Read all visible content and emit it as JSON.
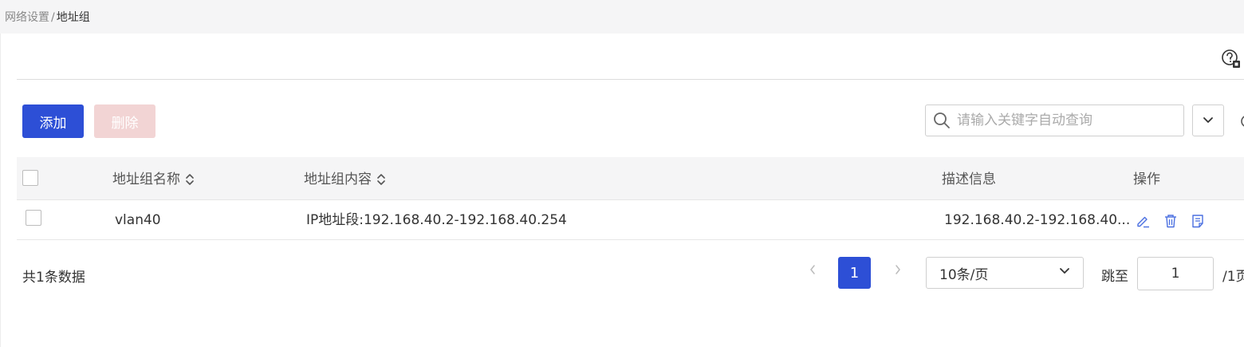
{
  "breadcrumb": {
    "parent": "网络设置",
    "separator": "/",
    "current": "地址组"
  },
  "toolbar": {
    "add_label": "添加",
    "delete_label": "删除"
  },
  "search": {
    "placeholder": "请输入关键字自动查询",
    "value": ""
  },
  "table": {
    "columns": [
      "地址组名称",
      "地址组内容",
      "描述信息",
      "操作"
    ],
    "rows": [
      {
        "name": "vlan40",
        "content": "IP地址段:192.168.40.2-192.168.40.254",
        "description": "192.168.40.2-192.168.40...",
        "actions": [
          "edit-icon",
          "delete-icon",
          "detail-icon"
        ]
      }
    ]
  },
  "pagination": {
    "total_text": "共1条数据",
    "current_page": "1",
    "page_size": "10条/页",
    "jump_label": "跳至",
    "jump_value": "1",
    "total_pages_text": "/1页"
  },
  "colors": {
    "primary": "#2d4fd6",
    "disabled_danger": "#f2d4d4",
    "header_bg": "#f5f5f6"
  }
}
